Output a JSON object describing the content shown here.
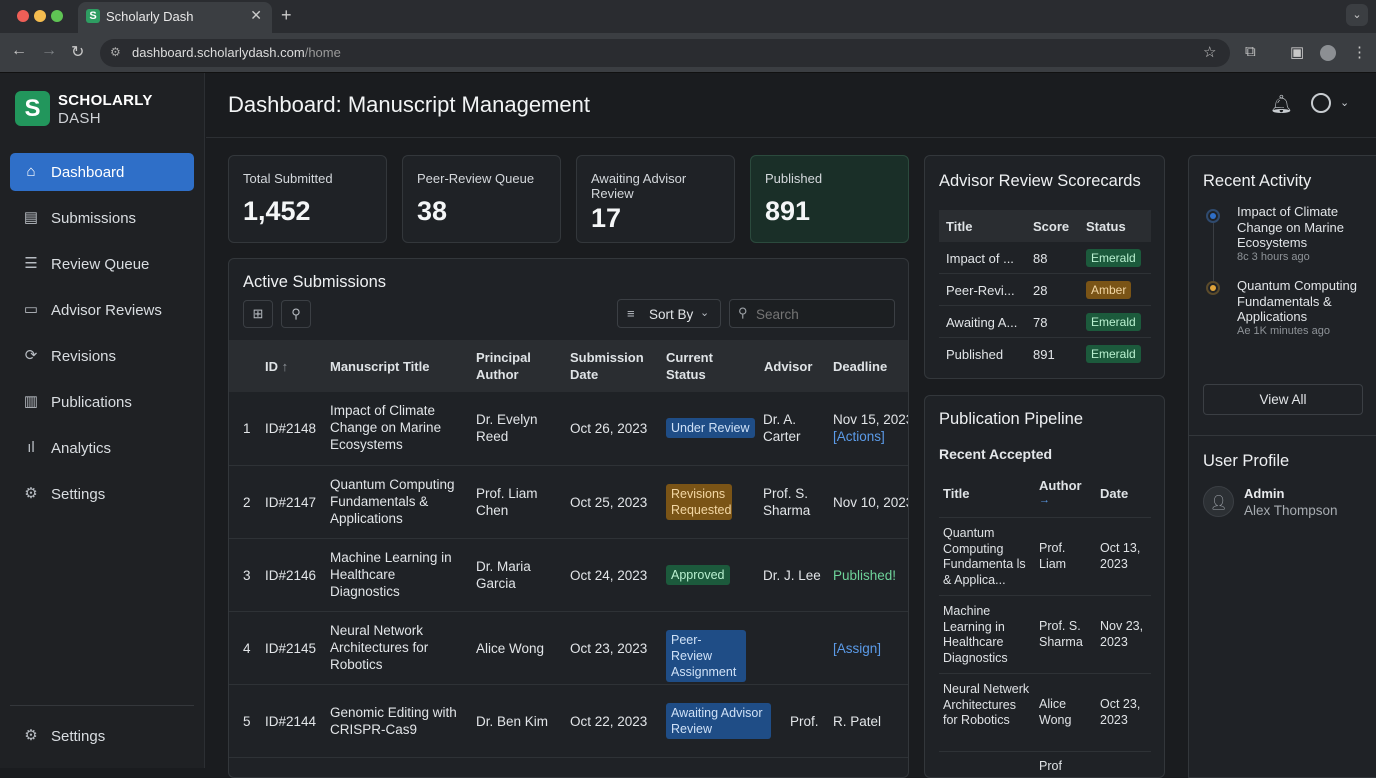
{
  "browser": {
    "tab_title": "Scholarly Dash",
    "tab_favicon": "S",
    "url_domain": "dashboard.scholarlydash.com",
    "url_path": "/home"
  },
  "brand": {
    "logo_letter": "S",
    "line1": "SCHOLARLY",
    "line2": "DASH",
    "color": "#22965c"
  },
  "sidebar": {
    "items": [
      {
        "label": "Dashboard",
        "icon": "home-icon",
        "active": true
      },
      {
        "label": "Submissions",
        "icon": "document-icon"
      },
      {
        "label": "Review Queue",
        "icon": "list-icon"
      },
      {
        "label": "Advisor Reviews",
        "icon": "comment-icon"
      },
      {
        "label": "Revisions",
        "icon": "refresh-icon"
      },
      {
        "label": "Publications",
        "icon": "publication-icon"
      },
      {
        "label": "Analytics",
        "icon": "bar-chart-icon"
      },
      {
        "label": "Settings",
        "icon": "gear-icon"
      }
    ],
    "footer_label": "Settings"
  },
  "header": {
    "title": "Dashboard: Manuscript Management"
  },
  "stats": [
    {
      "label": "Total Submitted",
      "value": "1,452"
    },
    {
      "label": "Peer-Review Queue",
      "value": "38"
    },
    {
      "label": "Awaiting Advisor Review",
      "value": "17"
    },
    {
      "label": "Published",
      "value": "891"
    }
  ],
  "submissions": {
    "title": "Active Submissions",
    "sort_label": "Sort By",
    "search_placeholder": "Search",
    "columns": [
      "ID",
      "Manuscript Title",
      "Principal Author",
      "Submission Date",
      "Current Status",
      "Advisor",
      "Deadline"
    ],
    "rows": [
      {
        "n": "1",
        "id": "ID#2148",
        "title": "Impact of Climate Change on Marine Ecosystems",
        "author": "Dr. Evelyn Reed",
        "date": "Oct 26, 2023",
        "status": "Under Review",
        "status_color": "blue",
        "advisor": "Dr. A. Carter",
        "deadline": "Nov 15, 2023",
        "deadline_link": "[Actions]"
      },
      {
        "n": "2",
        "id": "ID#2147",
        "title": "Quantum Computing Fundamentals & Applications",
        "author": "Prof. Liam Chen",
        "date": "Oct 25, 2023",
        "status": "Revisions Requested",
        "status_color": "amber",
        "advisor": "Prof. S. Sharma",
        "deadline": "Nov 10, 2023",
        "deadline_link": ""
      },
      {
        "n": "3",
        "id": "ID#2146",
        "title": "Machine Learning in Healthcare Diagnostics",
        "author": "Dr. Maria Garcia",
        "date": "Oct 24, 2023",
        "status": "Approved",
        "status_color": "green",
        "advisor": "Dr. J. Lee",
        "deadline": "Published!",
        "deadline_link": ""
      },
      {
        "n": "4",
        "id": "ID#2145",
        "title": "Neural Network Architectures for Robotics",
        "author": "Alice Wong",
        "date": "Oct 23, 2023",
        "status": "Peer-Review Assignment",
        "status_color": "blue",
        "advisor": "",
        "deadline": "[Assign]",
        "deadline_link": ""
      },
      {
        "n": "5",
        "id": "ID#2144",
        "title": "Genomic Editing with CRISPR-Cas9",
        "author": "Dr. Ben Kim",
        "date": "Oct 22, 2023",
        "status": "Awaiting Advisor Review",
        "status_color": "blue",
        "advisor": "Prof.",
        "deadline": "R. Patel",
        "deadline_link": ""
      }
    ]
  },
  "scorecards": {
    "title": "Advisor Review Scorecards",
    "columns": [
      "Title",
      "Score",
      "Status"
    ],
    "rows": [
      {
        "title": "Impact of ...",
        "score": "88",
        "status": "Emerald"
      },
      {
        "title": "Peer-Revi...",
        "score": "28",
        "status": "Amber"
      },
      {
        "title": "Awaiting A...",
        "score": "78",
        "status": "Emerald"
      },
      {
        "title": "Published",
        "score": "891",
        "status": "Emerald"
      }
    ]
  },
  "pipeline": {
    "title": "Publication Pipeline",
    "subtitle": "Recent Accepted",
    "columns": [
      "Title",
      "Author",
      "Date"
    ],
    "author_arrow": "→",
    "rows": [
      {
        "title": "Quantum Computing Fundamenta ls & Applica...",
        "author": "Prof. Liam",
        "date": "Oct 13, 2023"
      },
      {
        "title": "Machine Learning in Healthcare Diagnostics",
        "author": "Prof. S. Sharma",
        "date": "Nov 23, 2023"
      },
      {
        "title": "Neural Netwerk Architectures for Robotics",
        "author": "Alice Wong",
        "date": "Oct 23, 2023"
      },
      {
        "title": "",
        "author": "Prof",
        "date": ""
      }
    ]
  },
  "activity": {
    "title": "Recent Activity",
    "items": [
      {
        "text": "Impact of Climate Change on Marine Ecosystems",
        "time": "8c 3 hours ago",
        "color": "#2f6fc8"
      },
      {
        "text": "Quantum Computing Fundamentals & Applications",
        "time": "Ae 1K minutes ago",
        "color": "#e0a43a"
      }
    ],
    "view_all": "View All"
  },
  "profile": {
    "title": "User Profile",
    "role": "Admin",
    "name": "Alex Thompson"
  }
}
